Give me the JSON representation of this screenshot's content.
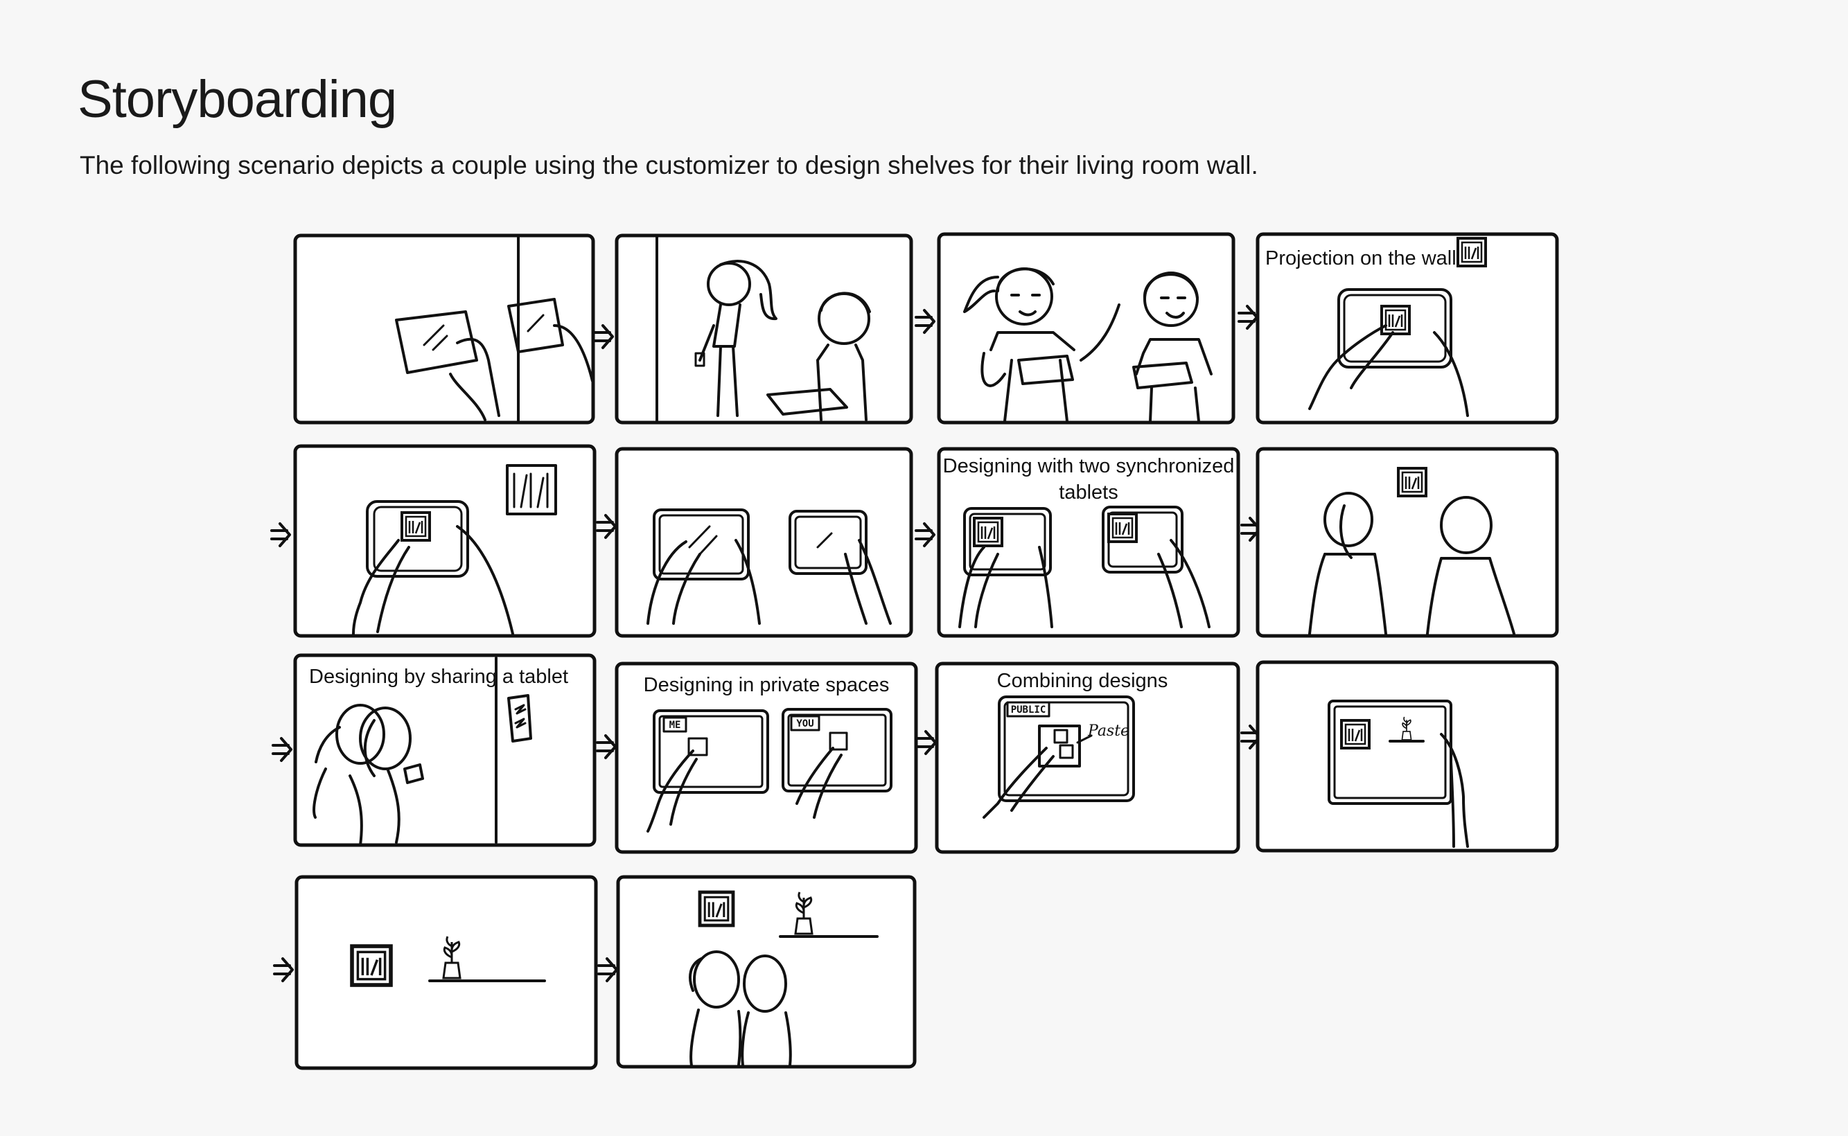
{
  "header": {
    "title": "Storyboarding",
    "subtitle": "The following scenario depicts a couple using the customizer to design shelves for their living room wall."
  },
  "panels": [
    {
      "caption": ""
    },
    {
      "caption": ""
    },
    {
      "caption": ""
    },
    {
      "caption": "Projection on the wall"
    },
    {
      "caption": ""
    },
    {
      "caption": ""
    },
    {
      "caption_line1": "Designing with two synchronized",
      "caption_line2": "tablets"
    },
    {
      "caption": ""
    },
    {
      "caption": "Designing by sharing a tablet"
    },
    {
      "caption": "Designing in private spaces",
      "left_tag": "ME",
      "right_tag": "YOU"
    },
    {
      "caption": "Combining designs",
      "tag": "PUBLIC",
      "note": "Paste"
    },
    {
      "caption": ""
    },
    {
      "caption": ""
    },
    {
      "caption": ""
    }
  ],
  "colors": {
    "ink": "#111111",
    "paper": "#ffffff",
    "background": "#f7f7f7"
  }
}
